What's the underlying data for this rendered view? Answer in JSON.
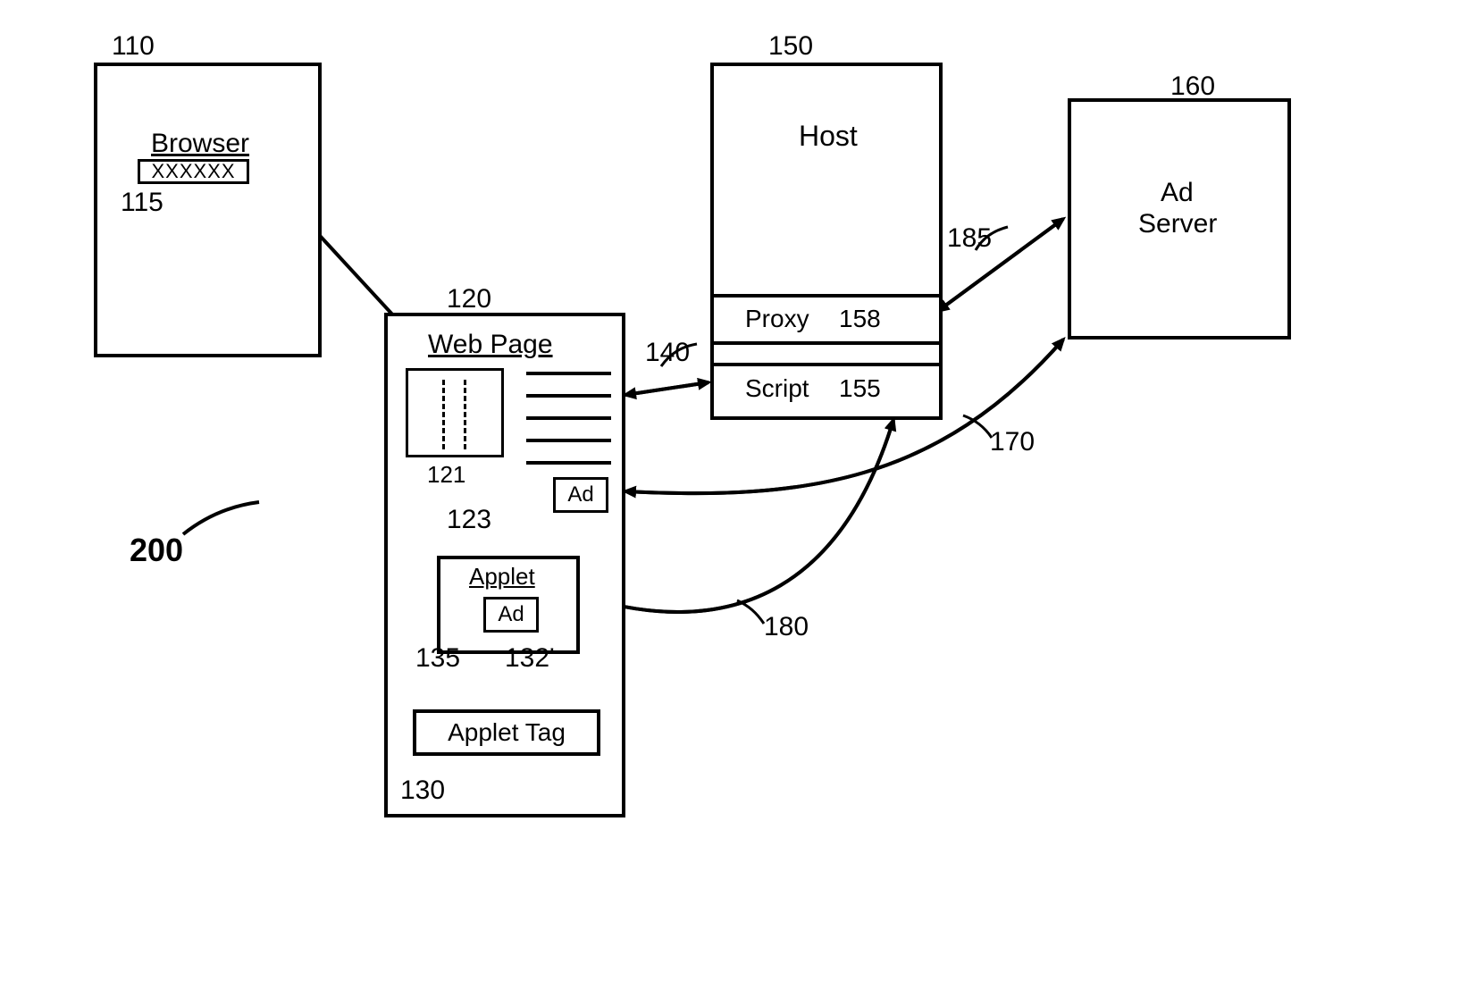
{
  "browser": {
    "label": "Browser",
    "xfield": "XXXXXX",
    "ref": "110",
    "xref": "115"
  },
  "webpage": {
    "label": "Web Page",
    "ref": "120",
    "image_ref": "121",
    "ad_label": "Ad",
    "ad_ref": "123",
    "applet": {
      "label": "Applet",
      "ad_label": "Ad",
      "ref_left": "135",
      "ref_right": "132'"
    },
    "applet_tag": {
      "label": "Applet Tag",
      "ref": "130"
    }
  },
  "host": {
    "label": "Host",
    "ref": "150",
    "proxy_label": "Proxy",
    "proxy_ref": "158",
    "script_label": "Script",
    "script_ref": "155"
  },
  "adserver": {
    "label_line1": "Ad",
    "label_line2": "Server",
    "ref": "160"
  },
  "arrows": {
    "a140": "140",
    "a170": "170",
    "a180": "180",
    "a185": "185"
  },
  "diagram_ref": "200"
}
